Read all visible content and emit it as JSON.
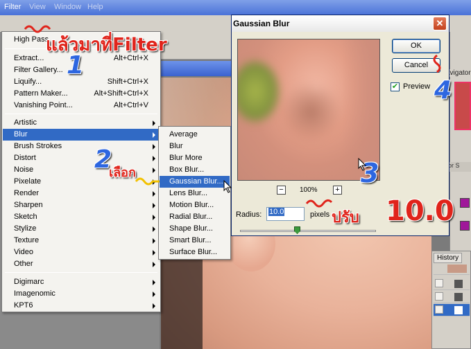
{
  "menubar": {
    "items": [
      "Filter",
      "View",
      "Window",
      "Help"
    ]
  },
  "filter_menu": {
    "items": [
      {
        "label": "High Pass",
        "shortcut": ""
      },
      {
        "label": "Extract...",
        "shortcut": "Alt+Ctrl+X"
      },
      {
        "label": "Filter Gallery...",
        "shortcut": ""
      },
      {
        "label": "Liquify...",
        "shortcut": "Shift+Ctrl+X"
      },
      {
        "label": "Pattern Maker...",
        "shortcut": "Alt+Shift+Ctrl+X"
      },
      {
        "label": "Vanishing Point...",
        "shortcut": "Alt+Ctrl+V"
      },
      {
        "label": "Artistic",
        "shortcut": ""
      },
      {
        "label": "Blur",
        "shortcut": ""
      },
      {
        "label": "Brush Strokes",
        "shortcut": ""
      },
      {
        "label": "Distort",
        "shortcut": ""
      },
      {
        "label": "Noise",
        "shortcut": ""
      },
      {
        "label": "Pixelate",
        "shortcut": ""
      },
      {
        "label": "Render",
        "shortcut": ""
      },
      {
        "label": "Sharpen",
        "shortcut": ""
      },
      {
        "label": "Sketch",
        "shortcut": ""
      },
      {
        "label": "Stylize",
        "shortcut": ""
      },
      {
        "label": "Texture",
        "shortcut": ""
      },
      {
        "label": "Video",
        "shortcut": ""
      },
      {
        "label": "Other",
        "shortcut": ""
      },
      {
        "label": "Digimarc",
        "shortcut": ""
      },
      {
        "label": "Imagenomic",
        "shortcut": ""
      },
      {
        "label": "KPT6",
        "shortcut": ""
      }
    ]
  },
  "blur_menu": {
    "items": [
      "Average",
      "Blur",
      "Blur More",
      "Box Blur...",
      "Gaussian Blur...",
      "Lens Blur...",
      "Motion Blur...",
      "Radial Blur...",
      "Shape Blur...",
      "Smart Blur...",
      "Surface Blur..."
    ]
  },
  "dialog": {
    "title": "Gaussian Blur",
    "close": "✕",
    "ok": "OK",
    "cancel": "Cancel",
    "preview_label": "Preview",
    "preview_checked": "✔",
    "zoom_out": "−",
    "zoom_in": "+",
    "zoom_level": "100%",
    "radius_label": "Radius:",
    "radius_value": "10.0",
    "radius_unit": "pixels"
  },
  "panels": {
    "navigator_tab": "avigator",
    "tabs2": "or  S",
    "history_tab": "History"
  },
  "annotations": {
    "step1_text": "แล้วมาที่Filter",
    "step1_num": "1",
    "step2_num": "2",
    "step2_text": "เลือก",
    "step3_num": "3",
    "step4_num": "4",
    "step5_text": "ปรับ",
    "step5_value": "10.0"
  },
  "colors": {
    "menu_highlight": "#316ac5",
    "annotation_red": "#e0241b",
    "annotation_blue": "#2d66e0"
  }
}
